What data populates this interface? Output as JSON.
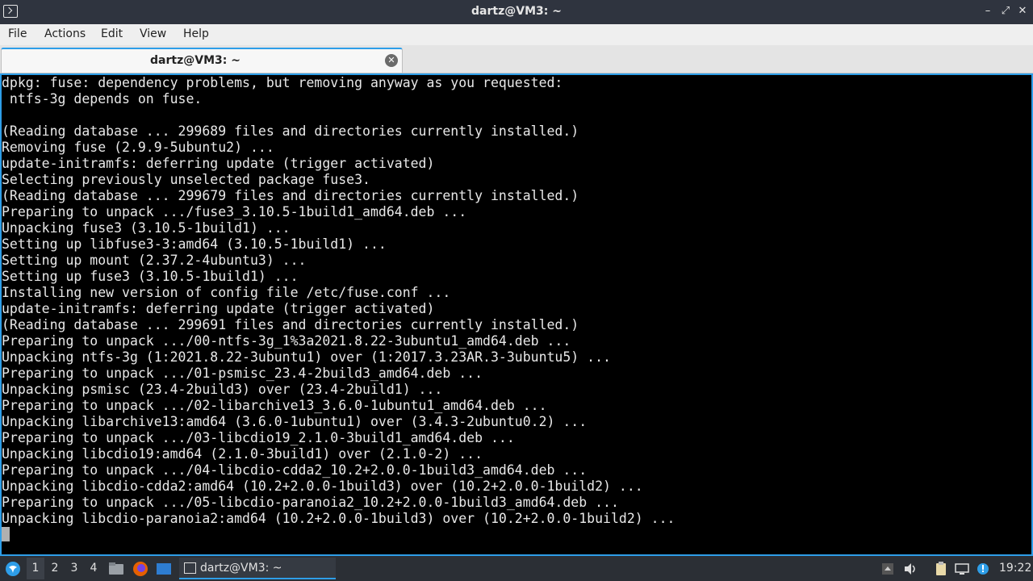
{
  "window": {
    "title": "dartz@VM3: ~",
    "minimize": "–",
    "maximize": "⤢",
    "close": "✕"
  },
  "menu": {
    "file": "File",
    "actions": "Actions",
    "edit": "Edit",
    "view": "View",
    "help": "Help"
  },
  "tab": {
    "label": "dartz@VM3: ~",
    "close": "✕"
  },
  "terminal": {
    "lines": [
      "dpkg: fuse: dependency problems, but removing anyway as you requested:",
      " ntfs-3g depends on fuse.",
      "",
      "(Reading database ... 299689 files and directories currently installed.)",
      "Removing fuse (2.9.9-5ubuntu2) ...",
      "update-initramfs: deferring update (trigger activated)",
      "Selecting previously unselected package fuse3.",
      "(Reading database ... 299679 files and directories currently installed.)",
      "Preparing to unpack .../fuse3_3.10.5-1build1_amd64.deb ...",
      "Unpacking fuse3 (3.10.5-1build1) ...",
      "Setting up libfuse3-3:amd64 (3.10.5-1build1) ...",
      "Setting up mount (2.37.2-4ubuntu3) ...",
      "Setting up fuse3 (3.10.5-1build1) ...",
      "Installing new version of config file /etc/fuse.conf ...",
      "update-initramfs: deferring update (trigger activated)",
      "(Reading database ... 299691 files and directories currently installed.)",
      "Preparing to unpack .../00-ntfs-3g_1%3a2021.8.22-3ubuntu1_amd64.deb ...",
      "Unpacking ntfs-3g (1:2021.8.22-3ubuntu1) over (1:2017.3.23AR.3-3ubuntu5) ...",
      "Preparing to unpack .../01-psmisc_23.4-2build3_amd64.deb ...",
      "Unpacking psmisc (23.4-2build3) over (23.4-2build1) ...",
      "Preparing to unpack .../02-libarchive13_3.6.0-1ubuntu1_amd64.deb ...",
      "Unpacking libarchive13:amd64 (3.6.0-1ubuntu1) over (3.4.3-2ubuntu0.2) ...",
      "Preparing to unpack .../03-libcdio19_2.1.0-3build1_amd64.deb ...",
      "Unpacking libcdio19:amd64 (2.1.0-3build1) over (2.1.0-2) ...",
      "Preparing to unpack .../04-libcdio-cdda2_10.2+2.0.0-1build3_amd64.deb ...",
      "Unpacking libcdio-cdda2:amd64 (10.2+2.0.0-1build3) over (10.2+2.0.0-1build2) ...",
      "Preparing to unpack .../05-libcdio-paranoia2_10.2+2.0.0-1build3_amd64.deb ...",
      "Unpacking libcdio-paranoia2:amd64 (10.2+2.0.0-1build3) over (10.2+2.0.0-1build2) ..."
    ]
  },
  "taskbar": {
    "workspaces": [
      "1",
      "2",
      "3",
      "4"
    ],
    "active_workspace": "1",
    "task_label": "dartz@VM3: ~",
    "clock": "19:22"
  },
  "icons": {
    "start": "start-menu-icon",
    "files": "file-manager-icon",
    "browser": "firefox-icon",
    "desktop": "show-desktop-icon",
    "tray": [
      "expand-tray-icon",
      "volume-icon",
      "clipboard-icon",
      "network-icon",
      "update-notifier-icon"
    ]
  },
  "colors": {
    "accent": "#2e9ee8",
    "terminal_bg": "#000000",
    "terminal_fg": "#e8e8e8"
  }
}
